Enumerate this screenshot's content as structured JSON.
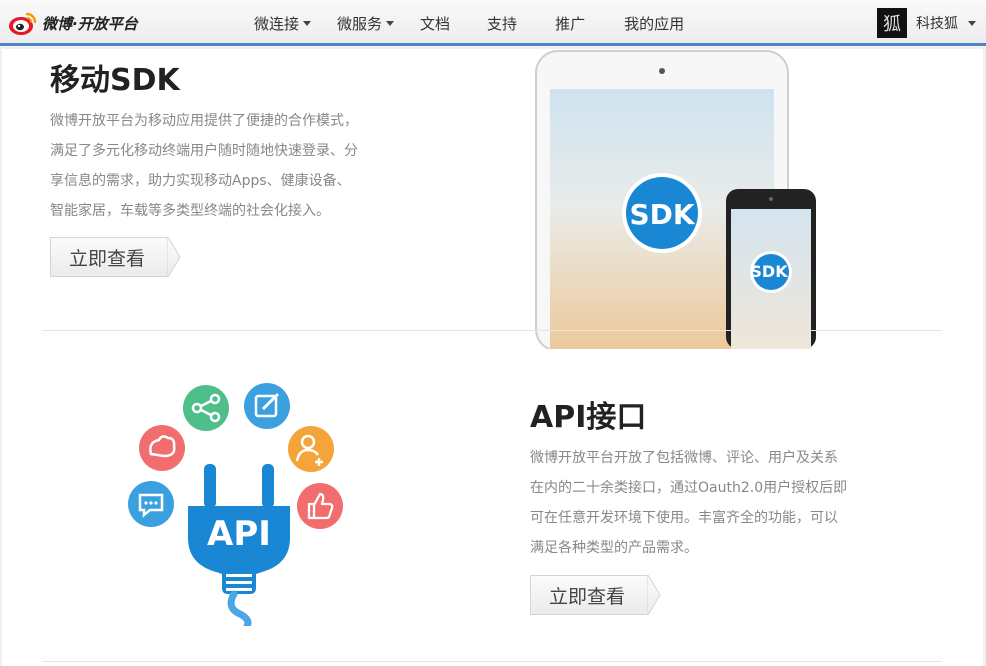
{
  "header": {
    "logo_text": "微博·开放平台",
    "nav": [
      {
        "label": "微连接",
        "dropdown": true
      },
      {
        "label": "微服务",
        "dropdown": true
      },
      {
        "label": "文档",
        "dropdown": false
      },
      {
        "label": "支持",
        "dropdown": false
      },
      {
        "label": "推广",
        "dropdown": false
      },
      {
        "label": "我的应用",
        "dropdown": false
      }
    ],
    "user": {
      "avatar_glyph": "狐",
      "name": "科技狐"
    }
  },
  "sdk": {
    "title": "移动SDK",
    "desc_lines": [
      "微博开放平台为移动应用提供了便捷的合作模式，",
      "满足了多元化移动终端用户随时随地快速登录、分",
      "享信息的需求，助力实现移动Apps、健康设备、",
      "智能家居，车载等多类型终端的社会化接入。"
    ],
    "button": "立即查看",
    "badge_large": "SDK",
    "badge_small": "SDK"
  },
  "api": {
    "title": "API接口",
    "desc_lines": [
      "微博开放平台开放了包括微博、评论、用户及关系",
      "在内的二十余类接口，通过Oauth2.0用户授权后即",
      "可在任意开发环境下使用。丰富齐全的功能，可以",
      "满足各种类型的产品需求。"
    ],
    "button": "立即查看",
    "plug_label": "API"
  },
  "colors": {
    "accent_blue": "#1a87d4",
    "nav_border": "#4a86c5",
    "icon_red": "#f26d6d",
    "icon_green": "#4fbf8a",
    "icon_blue": "#3aa0e0",
    "icon_orange": "#f5a43a"
  }
}
